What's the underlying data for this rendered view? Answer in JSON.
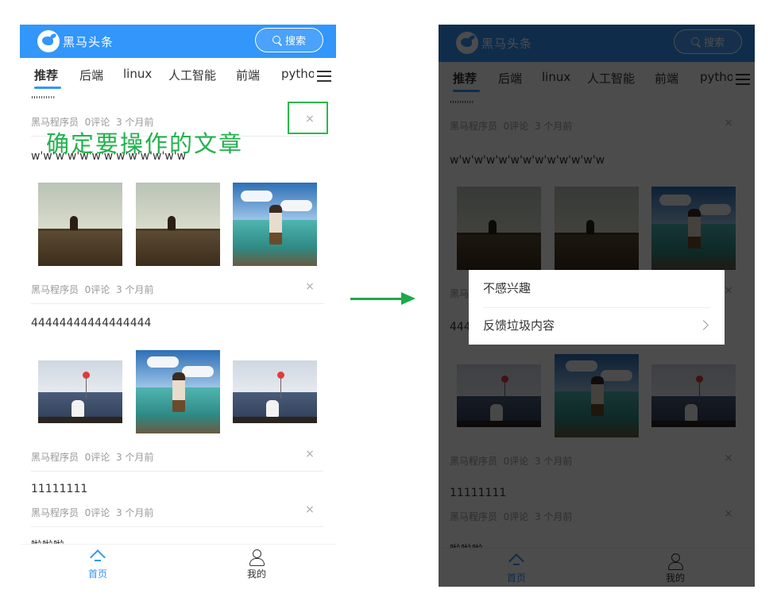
{
  "app": {
    "logo_text": "黑马头条",
    "search_label": "搜索",
    "tabs": [
      "推荐",
      "后端",
      "linux",
      "人工智能",
      "前端",
      "python"
    ]
  },
  "articles": [
    {
      "title": "''''''''''",
      "author": "黑马程序员",
      "comments": "0评论",
      "time": "3 个月前"
    },
    {
      "title": "w'w'w'w'w'w'w'w'w'w'w'w'w",
      "author": "黑马程序员",
      "comments": "0评论",
      "time": "3 个月前"
    },
    {
      "title": "44444444444444444",
      "author": "黑马程序员",
      "comments": "0评论",
      "time": "3 个月前"
    },
    {
      "title": "11111111",
      "author": "黑马程序员",
      "comments": "0评论",
      "time": "3 个月前"
    },
    {
      "title": "啦啦啦"
    }
  ],
  "close_glyph": "×",
  "bottom_nav": {
    "home": "首页",
    "mine": "我的"
  },
  "annotation": "确定要操作的文章",
  "popup": {
    "item1": "不感兴趣",
    "item2": "反馈垃圾内容"
  },
  "colors": {
    "brand": "#3296fa",
    "annotation": "#22b24c"
  }
}
